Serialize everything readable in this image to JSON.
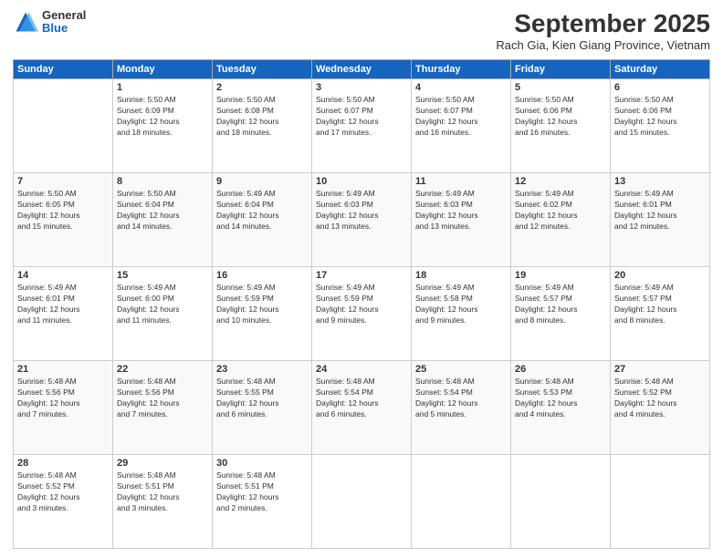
{
  "header": {
    "logo_general": "General",
    "logo_blue": "Blue",
    "month_title": "September 2025",
    "subtitle": "Rach Gia, Kien Giang Province, Vietnam"
  },
  "weekdays": [
    "Sunday",
    "Monday",
    "Tuesday",
    "Wednesday",
    "Thursday",
    "Friday",
    "Saturday"
  ],
  "weeks": [
    [
      {
        "day": null,
        "sunrise": null,
        "sunset": null,
        "daylight": null
      },
      {
        "day": "1",
        "sunrise": "5:50 AM",
        "sunset": "6:09 PM",
        "daylight": "12 hours and 18 minutes."
      },
      {
        "day": "2",
        "sunrise": "5:50 AM",
        "sunset": "6:08 PM",
        "daylight": "12 hours and 18 minutes."
      },
      {
        "day": "3",
        "sunrise": "5:50 AM",
        "sunset": "6:07 PM",
        "daylight": "12 hours and 17 minutes."
      },
      {
        "day": "4",
        "sunrise": "5:50 AM",
        "sunset": "6:07 PM",
        "daylight": "12 hours and 16 minutes."
      },
      {
        "day": "5",
        "sunrise": "5:50 AM",
        "sunset": "6:06 PM",
        "daylight": "12 hours and 16 minutes."
      },
      {
        "day": "6",
        "sunrise": "5:50 AM",
        "sunset": "6:06 PM",
        "daylight": "12 hours and 15 minutes."
      }
    ],
    [
      {
        "day": "7",
        "sunrise": "5:50 AM",
        "sunset": "6:05 PM",
        "daylight": "12 hours and 15 minutes."
      },
      {
        "day": "8",
        "sunrise": "5:50 AM",
        "sunset": "6:04 PM",
        "daylight": "12 hours and 14 minutes."
      },
      {
        "day": "9",
        "sunrise": "5:49 AM",
        "sunset": "6:04 PM",
        "daylight": "12 hours and 14 minutes."
      },
      {
        "day": "10",
        "sunrise": "5:49 AM",
        "sunset": "6:03 PM",
        "daylight": "12 hours and 13 minutes."
      },
      {
        "day": "11",
        "sunrise": "5:49 AM",
        "sunset": "6:03 PM",
        "daylight": "12 hours and 13 minutes."
      },
      {
        "day": "12",
        "sunrise": "5:49 AM",
        "sunset": "6:02 PM",
        "daylight": "12 hours and 12 minutes."
      },
      {
        "day": "13",
        "sunrise": "5:49 AM",
        "sunset": "6:01 PM",
        "daylight": "12 hours and 12 minutes."
      }
    ],
    [
      {
        "day": "14",
        "sunrise": "5:49 AM",
        "sunset": "6:01 PM",
        "daylight": "12 hours and 11 minutes."
      },
      {
        "day": "15",
        "sunrise": "5:49 AM",
        "sunset": "6:00 PM",
        "daylight": "12 hours and 11 minutes."
      },
      {
        "day": "16",
        "sunrise": "5:49 AM",
        "sunset": "5:59 PM",
        "daylight": "12 hours and 10 minutes."
      },
      {
        "day": "17",
        "sunrise": "5:49 AM",
        "sunset": "5:59 PM",
        "daylight": "12 hours and 9 minutes."
      },
      {
        "day": "18",
        "sunrise": "5:49 AM",
        "sunset": "5:58 PM",
        "daylight": "12 hours and 9 minutes."
      },
      {
        "day": "19",
        "sunrise": "5:49 AM",
        "sunset": "5:57 PM",
        "daylight": "12 hours and 8 minutes."
      },
      {
        "day": "20",
        "sunrise": "5:49 AM",
        "sunset": "5:57 PM",
        "daylight": "12 hours and 8 minutes."
      }
    ],
    [
      {
        "day": "21",
        "sunrise": "5:48 AM",
        "sunset": "5:56 PM",
        "daylight": "12 hours and 7 minutes."
      },
      {
        "day": "22",
        "sunrise": "5:48 AM",
        "sunset": "5:56 PM",
        "daylight": "12 hours and 7 minutes."
      },
      {
        "day": "23",
        "sunrise": "5:48 AM",
        "sunset": "5:55 PM",
        "daylight": "12 hours and 6 minutes."
      },
      {
        "day": "24",
        "sunrise": "5:48 AM",
        "sunset": "5:54 PM",
        "daylight": "12 hours and 6 minutes."
      },
      {
        "day": "25",
        "sunrise": "5:48 AM",
        "sunset": "5:54 PM",
        "daylight": "12 hours and 5 minutes."
      },
      {
        "day": "26",
        "sunrise": "5:48 AM",
        "sunset": "5:53 PM",
        "daylight": "12 hours and 4 minutes."
      },
      {
        "day": "27",
        "sunrise": "5:48 AM",
        "sunset": "5:52 PM",
        "daylight": "12 hours and 4 minutes."
      }
    ],
    [
      {
        "day": "28",
        "sunrise": "5:48 AM",
        "sunset": "5:52 PM",
        "daylight": "12 hours and 3 minutes."
      },
      {
        "day": "29",
        "sunrise": "5:48 AM",
        "sunset": "5:51 PM",
        "daylight": "12 hours and 3 minutes."
      },
      {
        "day": "30",
        "sunrise": "5:48 AM",
        "sunset": "5:51 PM",
        "daylight": "12 hours and 2 minutes."
      },
      {
        "day": null,
        "sunrise": null,
        "sunset": null,
        "daylight": null
      },
      {
        "day": null,
        "sunrise": null,
        "sunset": null,
        "daylight": null
      },
      {
        "day": null,
        "sunrise": null,
        "sunset": null,
        "daylight": null
      },
      {
        "day": null,
        "sunrise": null,
        "sunset": null,
        "daylight": null
      }
    ]
  ],
  "labels": {
    "sunrise_prefix": "Sunrise: ",
    "sunset_prefix": "Sunset: ",
    "daylight_prefix": "Daylight: "
  }
}
